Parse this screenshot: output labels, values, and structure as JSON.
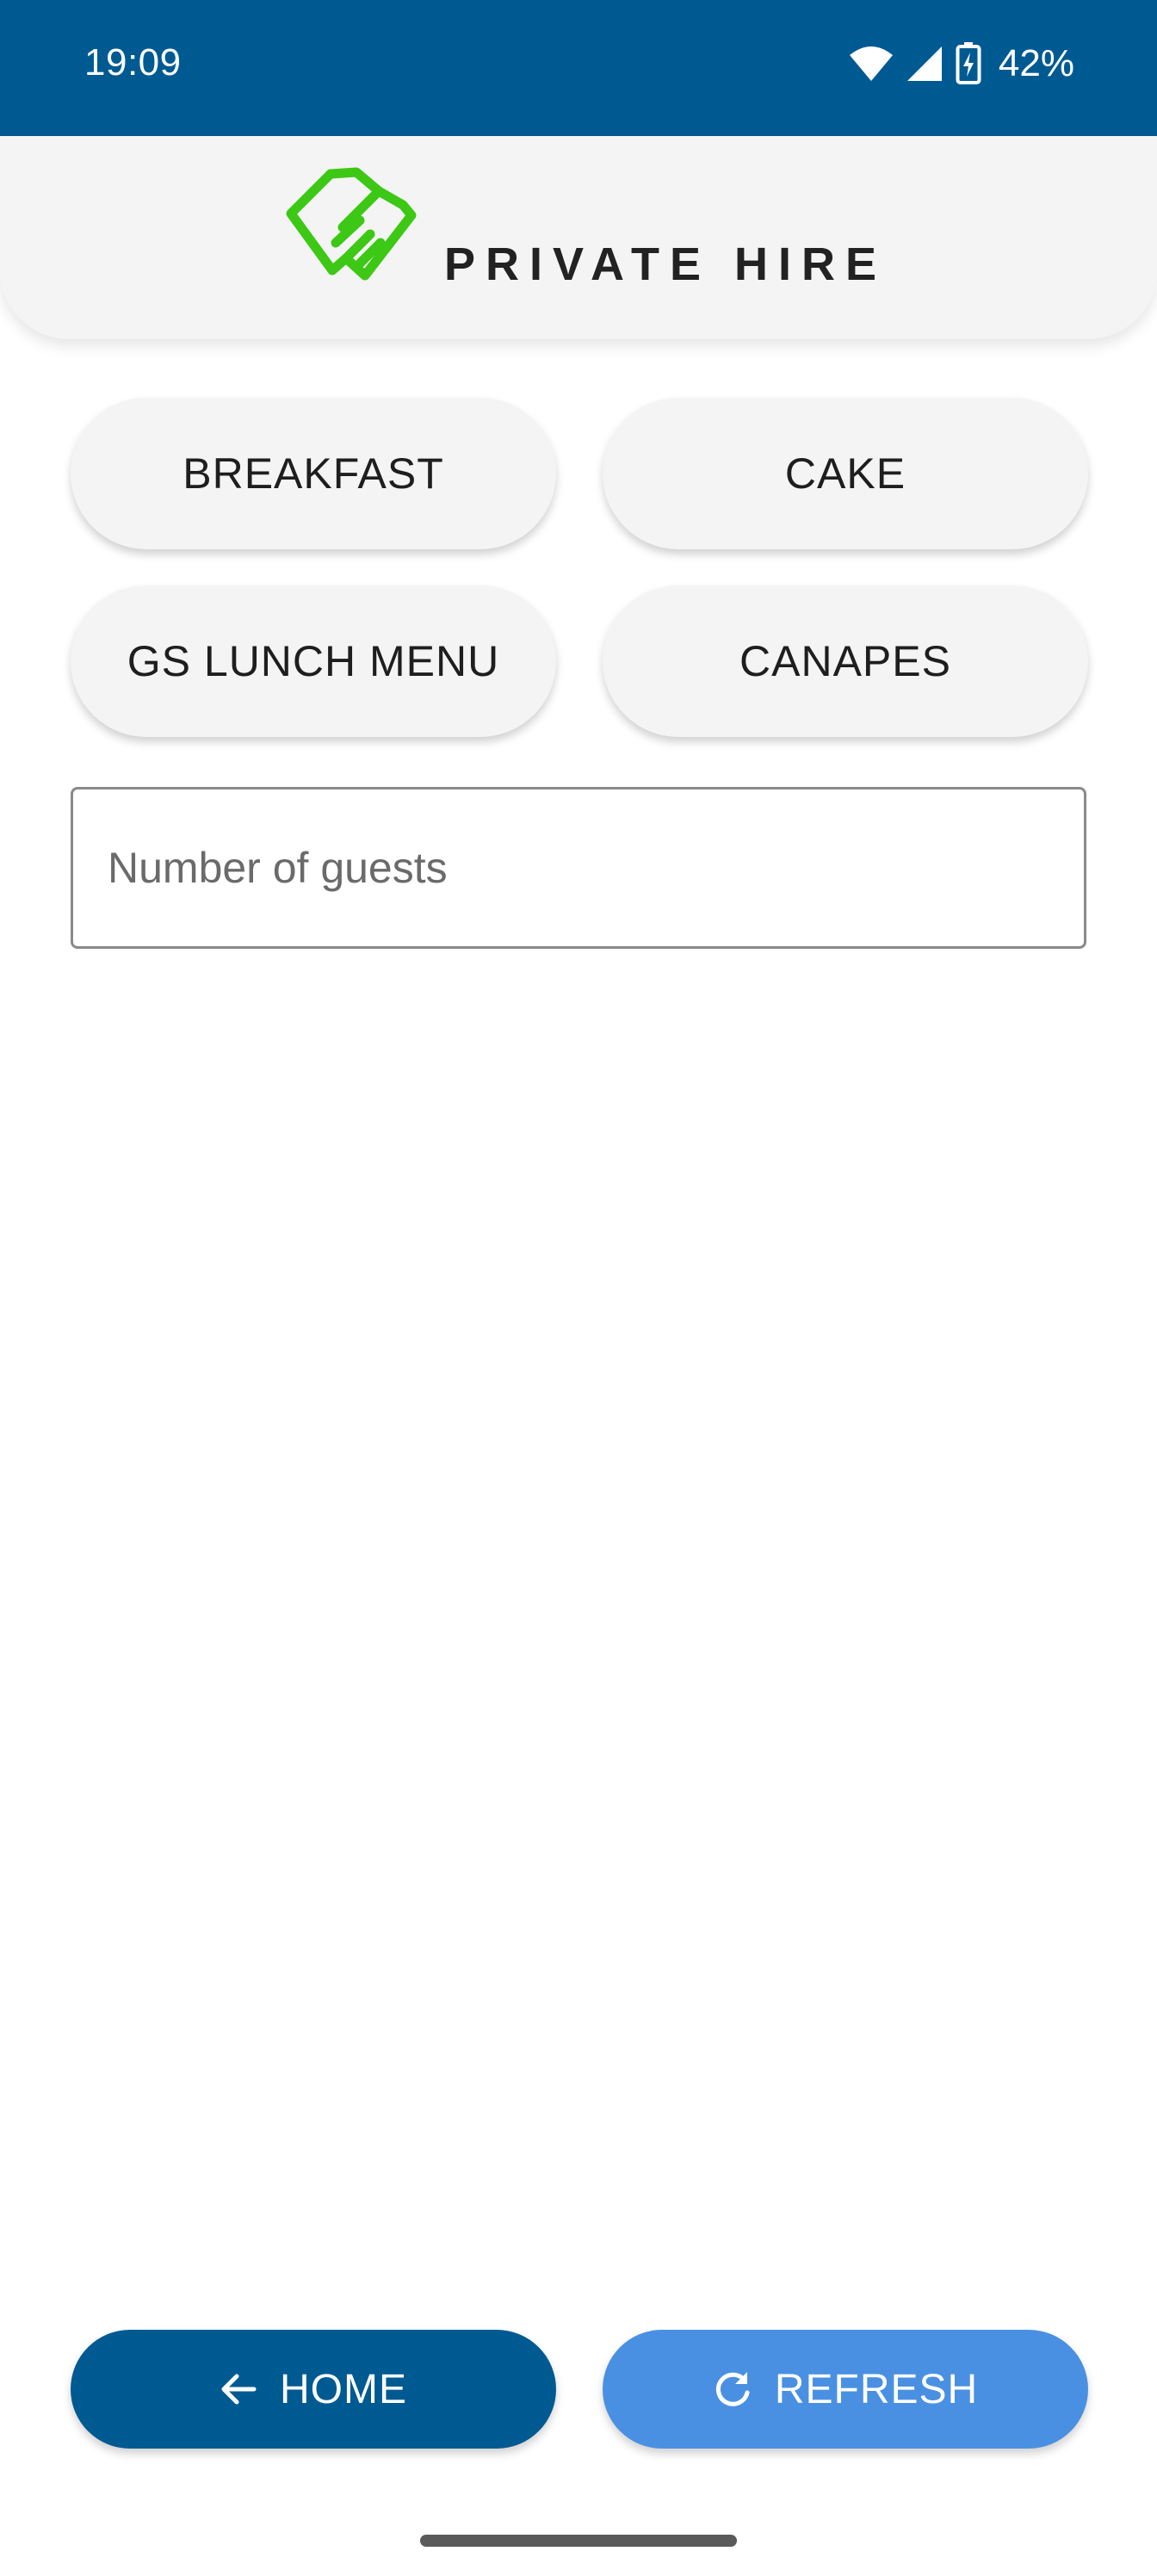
{
  "status_bar": {
    "time": "19:09",
    "battery": "42%",
    "icons": [
      "wifi-icon",
      "cellular-signal-icon",
      "battery-charging-icon"
    ]
  },
  "header": {
    "logo": "handshake-logo",
    "title": "PRIVATE HIRE"
  },
  "menu_buttons": {
    "breakfast": "BREAKFAST",
    "cake": "CAKE",
    "lunch": "GS LUNCH MENU",
    "canapes": "CANAPES"
  },
  "guests_input": {
    "value": "",
    "placeholder": "Number of guests"
  },
  "bottom_buttons": {
    "home": {
      "label": "HOME",
      "icon": "arrow-left-icon"
    },
    "refresh": {
      "label": "REFRESH",
      "icon": "refresh-icon"
    }
  },
  "colors": {
    "primary": "#005a92",
    "secondary": "#4a90e2",
    "logo_green": "#3cc814",
    "surface": "#f4f4f4"
  }
}
